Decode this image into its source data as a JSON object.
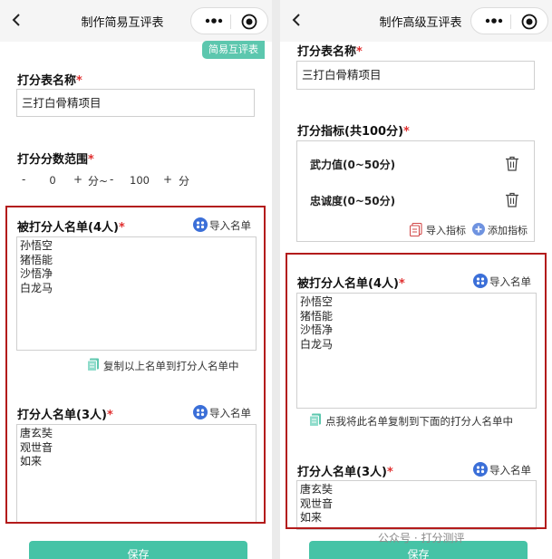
{
  "left": {
    "nav_title": "制作简易互评表",
    "tag": "简易互评表",
    "name_label": "打分表名称",
    "name_value": "三打白骨精项目",
    "range_label": "打分分数范围",
    "range": {
      "minus": "-",
      "plus": "+",
      "min_value": "0",
      "sep": "分~",
      "max_value": "100",
      "unit": "分"
    },
    "rated_label": "被打分人名单(4人)",
    "rated_names": [
      "孙悟空",
      "猪悟能",
      "沙悟净",
      "白龙马"
    ],
    "import_label": "导入名单",
    "copy_label": "复制以上名单到打分人名单中",
    "raters_label": "打分人名单(3人)",
    "raters_names": [
      "唐玄奘",
      "观世音",
      "如来"
    ],
    "save_label": "保存"
  },
  "right": {
    "nav_title": "制作高级互评表",
    "name_label": "打分表名称",
    "name_value": "三打白骨精项目",
    "metrics_label": "打分指标(共100分)",
    "metrics": [
      {
        "label": "武力值(0~50分)"
      },
      {
        "label": "忠诚度(0~50分)"
      }
    ],
    "import_metrics_label": "导入指标",
    "add_metric_label": "添加指标",
    "rated_label": "被打分人名单(4人)",
    "rated_names": [
      "孙悟空",
      "猪悟能",
      "沙悟净",
      "白龙马"
    ],
    "import_label": "导入名单",
    "copy_label": "点我将此名单复制到下面的打分人名单中",
    "raters_label": "打分人名单(3人)",
    "raters_names": [
      "唐玄奘",
      "观世音",
      "如来"
    ],
    "save_label": "保存"
  },
  "required_mark": "*",
  "watermark": "公众号 · 打分测评",
  "colors": {
    "accent": "#46c3a6",
    "tag": "#5cc7ae",
    "highlight_frame": "#b31b1b",
    "required": "#e03030",
    "icon_blue": "#3b6fd8"
  },
  "icons": [
    "back-icon",
    "more-icon",
    "target-icon",
    "people-icon",
    "copy-icon",
    "trash-icon",
    "import-metric-icon",
    "plus-circle-icon"
  ]
}
